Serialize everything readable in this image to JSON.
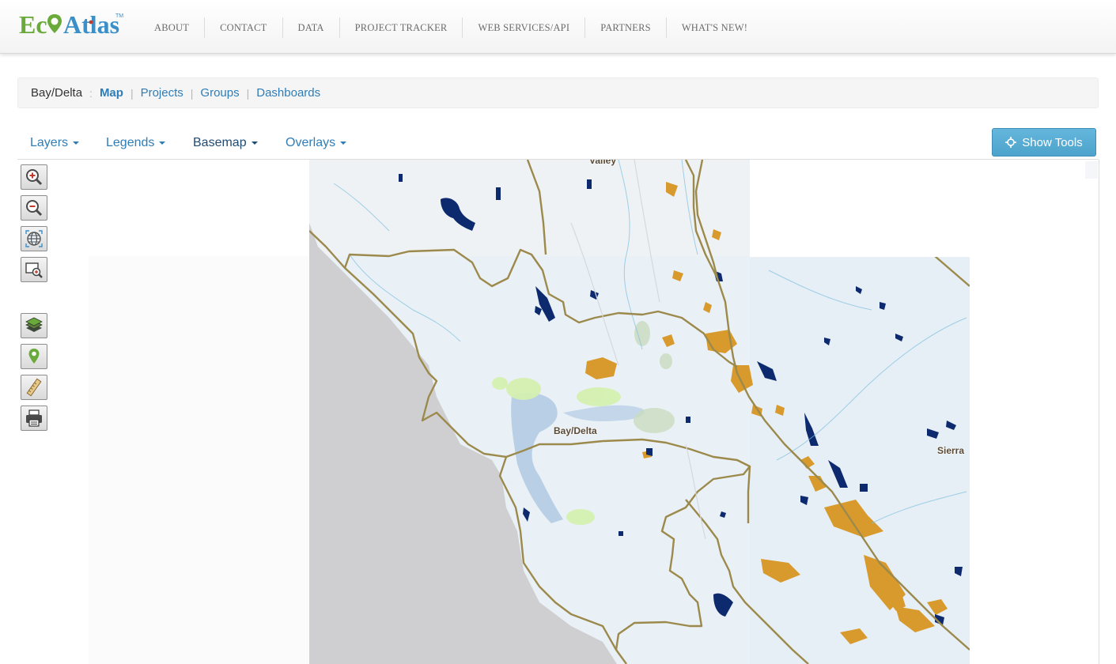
{
  "brand": {
    "name": "EcoAtlas",
    "tm": "TM"
  },
  "nav": {
    "items": [
      "ABOUT",
      "CONTACT",
      "DATA",
      "PROJECT TRACKER",
      "WEB SERVICES/API",
      "PARTNERS",
      "WHAT'S NEW!"
    ]
  },
  "breadcrumb": {
    "root": "Bay/Delta",
    "sep_colon": ":",
    "sep_pipe": "|",
    "links": [
      "Map",
      "Projects",
      "Groups",
      "Dashboards"
    ],
    "active": "Map"
  },
  "toolbar": {
    "layers_label": "Layers",
    "legends_label": "Legends",
    "basemap_label": "Basemap",
    "overlays_label": "Overlays",
    "show_tools_label": "Show Tools"
  },
  "map": {
    "labels": {
      "valley": "Valley",
      "region": "Bay/Delta",
      "sierra": "Sierra"
    },
    "tools": [
      "zoom-in-icon",
      "zoom-out-icon",
      "globe-icon",
      "zoom-box-icon",
      "layers-icon",
      "marker-icon",
      "ruler-icon",
      "print-icon"
    ]
  },
  "colors": {
    "link": "#2f7db6",
    "button": "#5bafd6",
    "boundary": "#9c8a4c",
    "water": "#0e2a6e",
    "orange_habitat": "#d89a2c",
    "land": "#e8f0f6",
    "ocean": "#cfcfd1"
  }
}
